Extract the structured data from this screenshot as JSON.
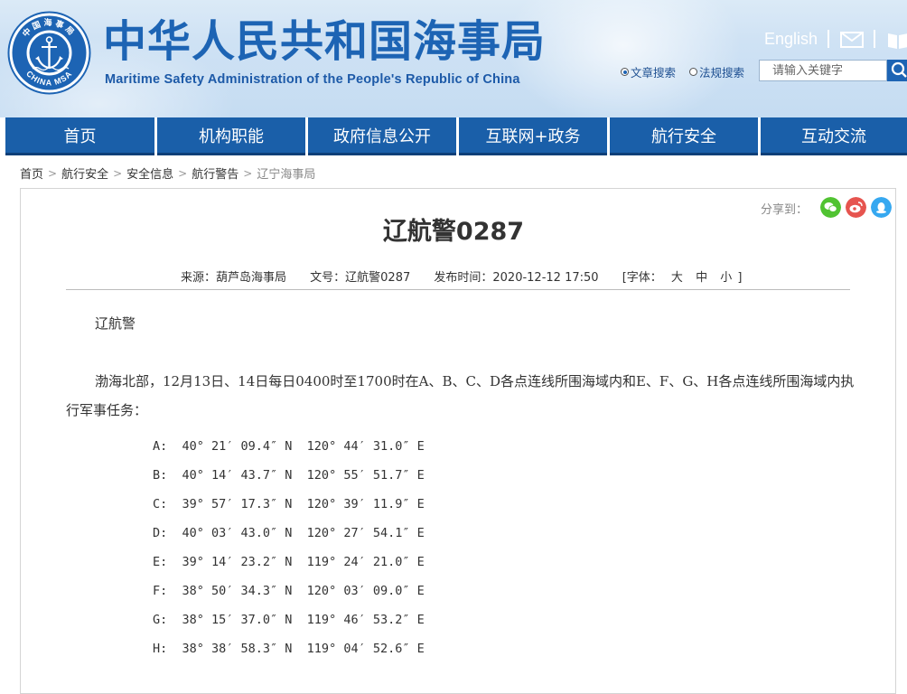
{
  "header": {
    "site_title": "中华人民共和国海事局",
    "site_subtitle": "Maritime Safety Administration of the People's Republic of China",
    "logo_top_text": "中国海事局",
    "logo_bottom_text": "CHINA MSA",
    "english_link": "English",
    "search_options": [
      "文章搜索",
      "法规搜索"
    ],
    "search_selected": "文章搜索",
    "search_placeholder": "请输入关键字"
  },
  "nav": {
    "items": [
      "首页",
      "机构职能",
      "政府信息公开",
      "互联网+政务",
      "航行安全",
      "互动交流"
    ]
  },
  "breadcrumb": [
    "首页",
    "航行安全",
    "安全信息",
    "航行警告",
    "辽宁海事局"
  ],
  "share": {
    "label": "分享到：",
    "icons": [
      "wechat-icon",
      "weibo-icon",
      "qq-icon"
    ]
  },
  "article": {
    "title": "辽航警0287",
    "source": "来源：葫芦岛海事局",
    "doc_no": "文号：辽航警0287",
    "published": "发布时间：2020-12-12 17:50",
    "font_size_label": "[字体：",
    "font_sizes": [
      "大",
      "中",
      "小"
    ],
    "font_size_end": "]",
    "heading": "辽航警",
    "body_line1": "渤海北部，12月13日、14日每日0400时至1700时在A、B、C、D各点连线所围海域内和E、F、G、H各点连线所围海域内执",
    "body_line2": "行军事任务：",
    "coordinates": [
      "A:  40° 21′ 09.4″ N  120° 44′ 31.0″ E",
      "B:  40° 14′ 43.7″ N  120° 55′ 51.7″ E",
      "C:  39° 57′ 17.3″ N  120° 39′ 11.9″ E",
      "D:  40° 03′ 43.0″ N  120° 27′ 54.1″ E",
      "E:  39° 14′ 23.2″ N  119° 24′ 21.0″ E",
      "F:  38° 50′ 34.3″ N  120° 03′ 09.0″ E",
      "G:  38° 15′ 37.0″ N  119° 46′ 53.2″ E",
      "H:  38° 38′ 58.3″ N  119° 04′ 52.6″ E"
    ]
  },
  "colors": {
    "brand_blue": "#1d64b4",
    "nav_blue": "#1a5fa9",
    "wechat_green": "#51c332",
    "weibo_red": "#e6544f",
    "qq_blue": "#36a8f0"
  }
}
